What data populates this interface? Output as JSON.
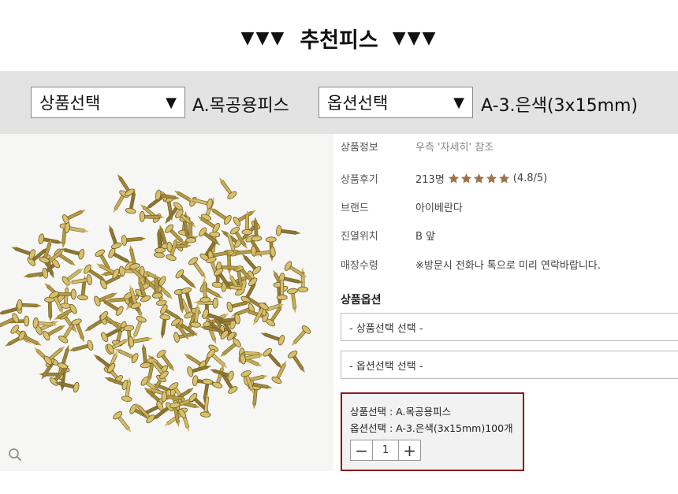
{
  "heading": {
    "left_marks": "▼▼▼",
    "title": "추천피스",
    "right_marks": "▼▼▼"
  },
  "option_bar": {
    "product_select": {
      "label": "상품선택",
      "arrow": "▼"
    },
    "product_value": "A.목공용피스",
    "option_select": {
      "label": "옵션선택",
      "arrow": "▼"
    },
    "option_value": "A-3.은색(3x15mm)"
  },
  "product_image": {
    "subject": "gold-zinc-screws-pile",
    "zoom_icon": "magnifier-icon"
  },
  "details": [
    {
      "key": "상품정보",
      "value": "우측 '자세히' 참조"
    },
    {
      "key": "상품후기",
      "count": "213명",
      "rating_text": "(4.8/5)",
      "rating": 4.8,
      "stars": 5
    },
    {
      "key": "브랜드",
      "value": "아이베란다"
    },
    {
      "key": "진열위치",
      "value": "B 앞"
    },
    {
      "key": "매장수령",
      "value": "※방문시 전화나 톡으로 미리 연락바랍니다."
    }
  ],
  "options_section": {
    "title": "상품옵션",
    "product_dropdown": "- 상품선택 선택 -",
    "option_dropdown": "- 옵션선택 선택 -"
  },
  "cart": {
    "line1": "상품선택 : A.목공용피스",
    "line2": "옵션선택 : A-3.은색(3x15mm)100개",
    "minus": "−",
    "quantity": "1",
    "plus": "+"
  },
  "colors": {
    "star": "#a0734a",
    "cart_border": "#8b1a1a",
    "bar_bg": "#e3e3e3"
  }
}
